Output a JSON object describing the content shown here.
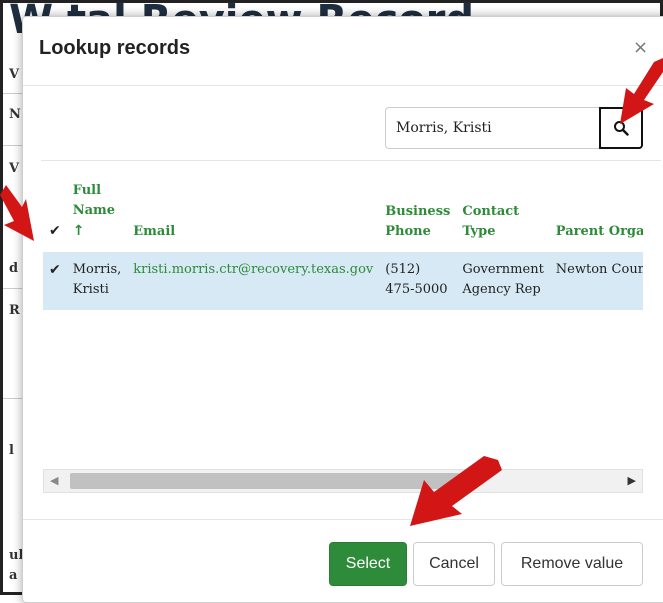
{
  "background": {
    "title_fragment": "W         tal Review Record",
    "side_fragments": [
      "V",
      "N",
      "V",
      "d",
      "R",
      "l",
      "ul",
      "a"
    ]
  },
  "modal": {
    "title": "Lookup records",
    "close_label": "×",
    "search": {
      "value": "Morris, Kristi",
      "icon": "search-icon"
    },
    "table": {
      "columns": [
        "Full Name",
        "Email",
        "Business Phone",
        "Contact Type",
        "Parent Organiz"
      ],
      "sort_indicator": "↑",
      "rows": [
        {
          "full_name": "Morris, Kristi",
          "email": "kristi.morris.ctr@recovery.texas.gov",
          "business_phone": "(512) 475-5000",
          "contact_type": "Government Agency Rep",
          "parent_org": "Newton County",
          "selected": true
        }
      ]
    },
    "buttons": {
      "select": "Select",
      "cancel": "Cancel",
      "remove": "Remove value"
    }
  },
  "colors": {
    "accent": "#2e8b3a",
    "selected_row": "#d6e9f5",
    "arrow": "#d21515"
  }
}
